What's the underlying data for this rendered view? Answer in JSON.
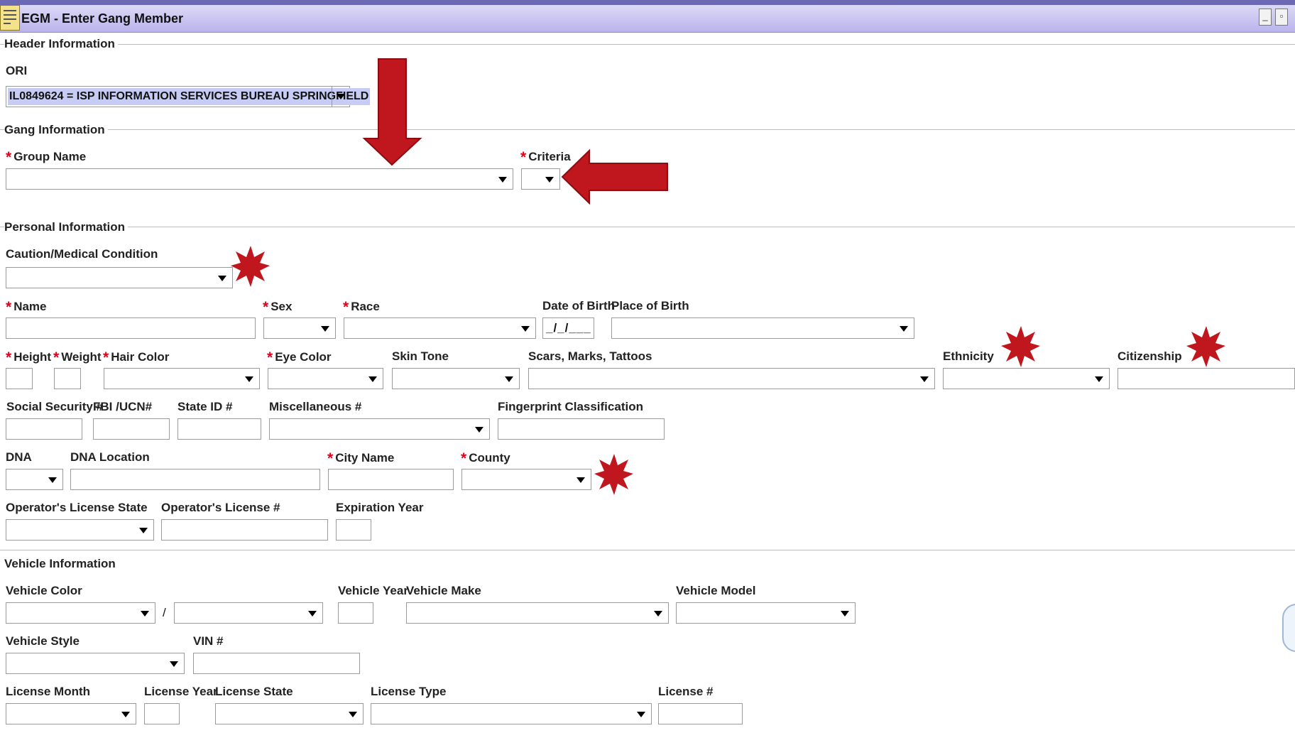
{
  "window": {
    "title": "EGM - Enter Gang Member"
  },
  "sections": {
    "header": "Header Information",
    "gang": "Gang Information",
    "personal": "Personal Information",
    "vehicle": "Vehicle Information"
  },
  "header": {
    "ori_label": "ORI",
    "ori_value": "IL0849624 = ISP INFORMATION SERVICES BUREAU SPRINGFIELD"
  },
  "gang": {
    "group_name_label": "Group Name",
    "criteria_label": "Criteria"
  },
  "personal": {
    "caution_label": "Caution/Medical Condition",
    "name_label": "Name",
    "sex_label": "Sex",
    "race_label": "Race",
    "dob_label": "Date of Birth",
    "dob_value": "_/_/___",
    "pob_label": "Place of Birth",
    "height_label": "Height",
    "weight_label": "Weight",
    "hair_label": "Hair Color",
    "eye_label": "Eye Color",
    "skin_label": "Skin Tone",
    "smt_label": "Scars, Marks, Tattoos",
    "ethnicity_label": "Ethnicity",
    "citizenship_label": "Citizenship",
    "ssn_label": "Social Security #",
    "fbi_label": "FBI /UCN#",
    "stateid_label": "State ID #",
    "misc_label": "Miscellaneous #",
    "fingerprint_label": "Fingerprint Classification",
    "dna_label": "DNA",
    "dna_loc_label": "DNA Location",
    "city_label": "City Name",
    "county_label": "County",
    "ol_state_label": "Operator's License State",
    "ol_num_label": "Operator's License #",
    "exp_year_label": "Expiration Year"
  },
  "vehicle": {
    "color_label": "Vehicle Color",
    "color_sep": "/",
    "year_label": "Vehicle Year",
    "make_label": "Vehicle Make",
    "model_label": "Vehicle Model",
    "style_label": "Vehicle Style",
    "vin_label": "VIN #",
    "lic_month_label": "License Month",
    "lic_year_label": "License Year",
    "lic_state_label": "License State",
    "lic_type_label": "License Type",
    "lic_num_label": "License #"
  },
  "colors": {
    "title_bar": "#c4c0f0",
    "required": "#e3001b",
    "annotation": "#c0161d",
    "selection": "#c7ccf5"
  },
  "icons": {
    "app": "notepad-icon",
    "minimize": "minimize-icon",
    "restore": "restore-icon"
  }
}
